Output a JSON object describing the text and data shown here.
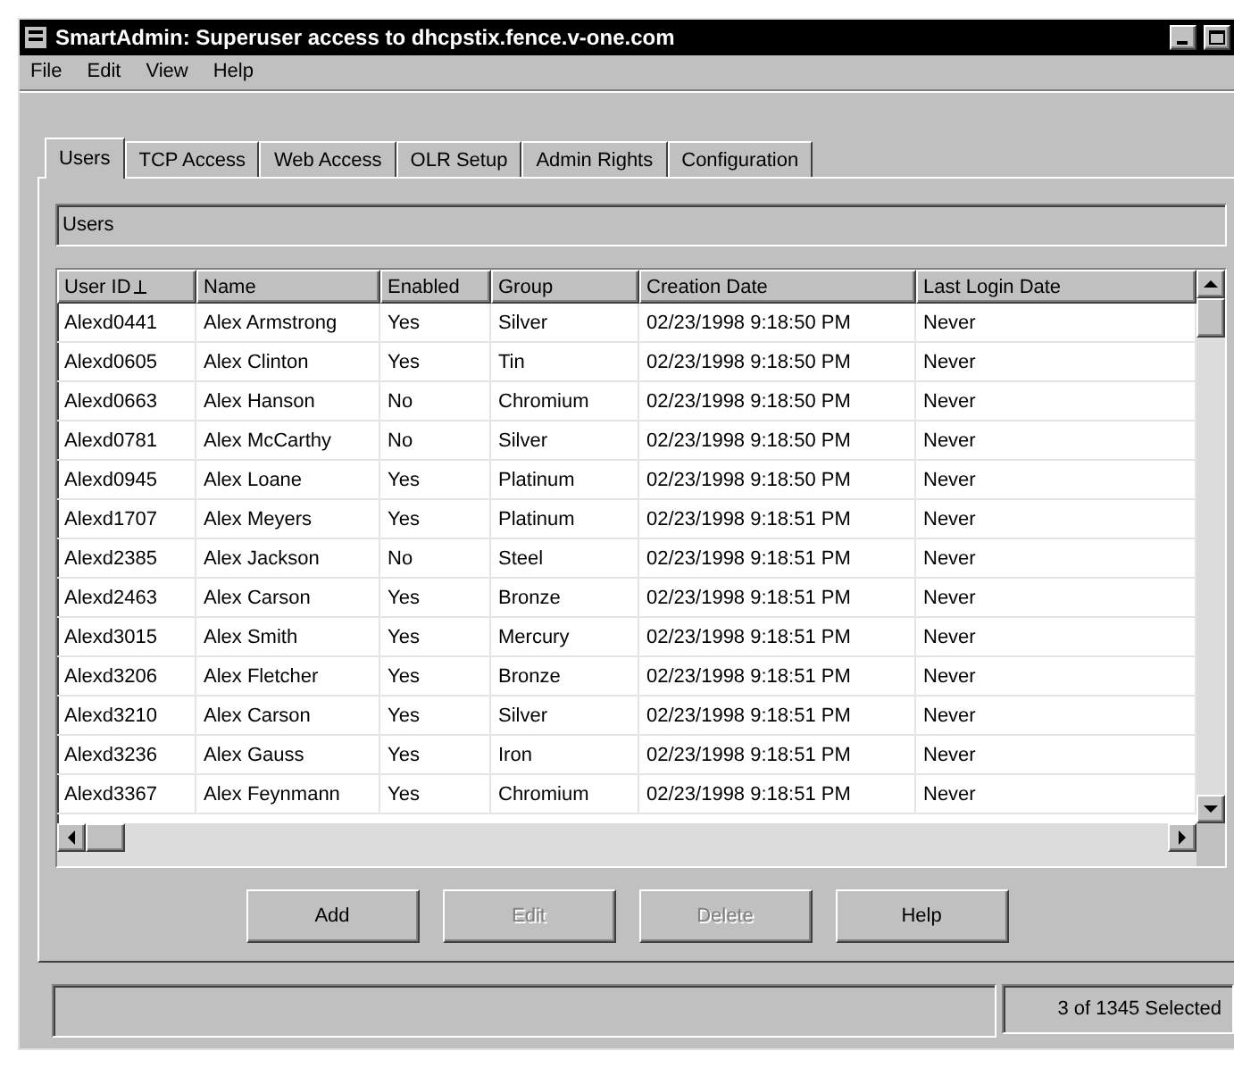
{
  "window": {
    "title": "SmartAdmin:  Superuser access to dhcpstix.fence.v-one.com"
  },
  "menu": [
    "File",
    "Edit",
    "View",
    "Help"
  ],
  "tabs": [
    {
      "label": "Users",
      "selected": true
    },
    {
      "label": "TCP Access",
      "selected": false
    },
    {
      "label": "Web Access",
      "selected": false
    },
    {
      "label": "OLR Setup",
      "selected": false
    },
    {
      "label": "Admin Rights",
      "selected": false
    },
    {
      "label": "Configuration",
      "selected": false
    }
  ],
  "section_label": "Users",
  "table": {
    "columns": [
      "User ID",
      "Name",
      "Enabled",
      "Group",
      "Creation Date",
      "Last Login Date"
    ],
    "rows": [
      [
        "Alexd0441",
        "Alex Armstrong",
        "Yes",
        "Silver",
        "02/23/1998 9:18:50 PM",
        "Never"
      ],
      [
        "Alexd0605",
        "Alex Clinton",
        "Yes",
        "Tin",
        "02/23/1998 9:18:50 PM",
        "Never"
      ],
      [
        "Alexd0663",
        "Alex Hanson",
        "No",
        "Chromium",
        "02/23/1998 9:18:50 PM",
        "Never"
      ],
      [
        "Alexd0781",
        "Alex McCarthy",
        "No",
        "Silver",
        "02/23/1998 9:18:50 PM",
        "Never"
      ],
      [
        "Alexd0945",
        "Alex Loane",
        "Yes",
        "Platinum",
        "02/23/1998 9:18:50 PM",
        "Never"
      ],
      [
        "Alexd1707",
        "Alex Meyers",
        "Yes",
        "Platinum",
        "02/23/1998 9:18:51 PM",
        "Never"
      ],
      [
        "Alexd2385",
        "Alex Jackson",
        "No",
        "Steel",
        "02/23/1998 9:18:51 PM",
        "Never"
      ],
      [
        "Alexd2463",
        "Alex Carson",
        "Yes",
        "Bronze",
        "02/23/1998 9:18:51 PM",
        "Never"
      ],
      [
        "Alexd3015",
        "Alex Smith",
        "Yes",
        "Mercury",
        "02/23/1998 9:18:51 PM",
        "Never"
      ],
      [
        "Alexd3206",
        "Alex Fletcher",
        "Yes",
        "Bronze",
        "02/23/1998 9:18:51 PM",
        "Never"
      ],
      [
        "Alexd3210",
        "Alex Carson",
        "Yes",
        "Silver",
        "02/23/1998 9:18:51 PM",
        "Never"
      ],
      [
        "Alexd3236",
        "Alex Gauss",
        "Yes",
        "Iron",
        "02/23/1998 9:18:51 PM",
        "Never"
      ],
      [
        "Alexd3367",
        "Alex Feynmann",
        "Yes",
        "Chromium",
        "02/23/1998 9:18:51 PM",
        "Never"
      ]
    ]
  },
  "buttons": [
    {
      "label": "Add",
      "disabled": false
    },
    {
      "label": "Edit",
      "disabled": true
    },
    {
      "label": "Delete",
      "disabled": true
    },
    {
      "label": "Help",
      "disabled": false
    }
  ],
  "status_bar": {
    "selection": "3 of 1345 Selected"
  }
}
